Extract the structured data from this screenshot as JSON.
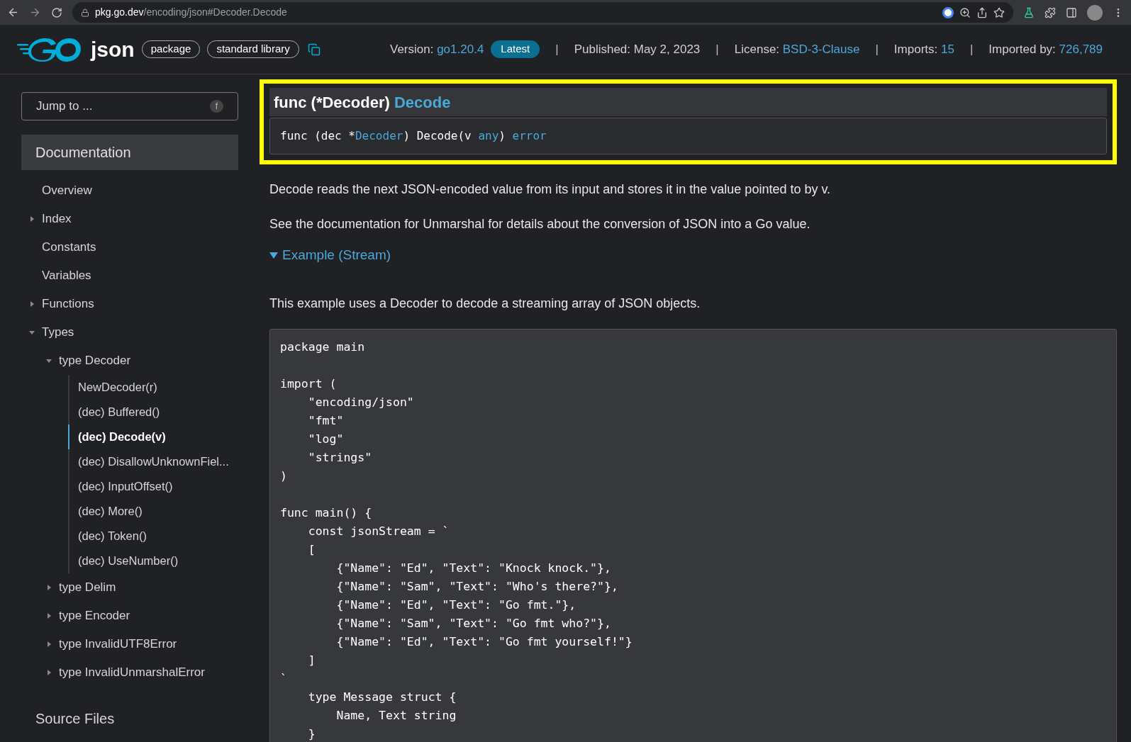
{
  "browser": {
    "url_host": "pkg.go.dev",
    "url_path": "/encoding/json#Decoder.Decode"
  },
  "header": {
    "title": "json",
    "badges": [
      "package",
      "standard library"
    ],
    "meta": [
      {
        "label": "Version: ",
        "value": "go1.20.4",
        "badge": "Latest"
      },
      {
        "separator": "|",
        "label": "Published: May 2, 2023"
      },
      {
        "separator": "|",
        "label": "License: ",
        "value": "BSD-3-Clause"
      },
      {
        "separator": "|",
        "label": "Imports: ",
        "value": "15"
      },
      {
        "separator": "|",
        "label": "Imported by: ",
        "value": "726,789"
      }
    ]
  },
  "sidebar": {
    "jump": {
      "placeholder": "Jump to ...",
      "shortcut": "f"
    },
    "section": "Documentation",
    "items": [
      {
        "label": "Overview"
      },
      {
        "label": "Index",
        "expanded": false
      },
      {
        "label": "Constants"
      },
      {
        "label": "Variables"
      },
      {
        "label": "Functions",
        "expanded": false
      },
      {
        "label": "Types",
        "expanded": true,
        "children": [
          {
            "label": "type Decoder",
            "expanded": true,
            "children": [
              {
                "label": "NewDecoder(r)",
                "selected": false
              },
              {
                "label": "(dec) Buffered()",
                "selected": false
              },
              {
                "label": "(dec) Decode(v)",
                "selected": true
              },
              {
                "label": "(dec) DisallowUnknownFiel...",
                "selected": false
              },
              {
                "label": "(dec) InputOffset()",
                "selected": false
              },
              {
                "label": "(dec) More()",
                "selected": false
              },
              {
                "label": "(dec) Token()",
                "selected": false
              },
              {
                "label": "(dec) UseNumber()",
                "selected": false
              }
            ]
          },
          {
            "label": "type Delim",
            "expanded": false
          },
          {
            "label": "type Encoder",
            "expanded": false
          },
          {
            "label": "type InvalidUTF8Error",
            "expanded": false
          },
          {
            "label": "type InvalidUnmarshalError",
            "expanded": false
          }
        ]
      }
    ],
    "footer": "Source Files"
  },
  "main": {
    "heading": {
      "prefix": "func (*Decoder) ",
      "name": "Decode"
    },
    "signature": [
      {
        "text": "func (dec *",
        "link": false
      },
      {
        "text": "Decoder",
        "link": true
      },
      {
        "text": ") Decode(v ",
        "link": false
      },
      {
        "text": "any",
        "link": true
      },
      {
        "text": ") ",
        "link": false
      },
      {
        "text": "error",
        "link": true
      }
    ],
    "paragraphs": [
      "Decode reads the next JSON-encoded value from its input and stores it in the value pointed to by v.",
      "See the documentation for Unmarshal for details about the conversion of JSON into a Go value."
    ],
    "example": {
      "label": "Example (Stream)",
      "expanded": true,
      "description": "This example uses a Decoder to decode a streaming array of JSON objects.",
      "code": "package main\n\nimport (\n\t\"encoding/json\"\n\t\"fmt\"\n\t\"log\"\n\t\"strings\"\n)\n\nfunc main() {\n\tconst jsonStream = `\n\t[\n\t\t{\"Name\": \"Ed\", \"Text\": \"Knock knock.\"},\n\t\t{\"Name\": \"Sam\", \"Text\": \"Who's there?\"},\n\t\t{\"Name\": \"Ed\", \"Text\": \"Go fmt.\"},\n\t\t{\"Name\": \"Sam\", \"Text\": \"Go fmt who?\"},\n\t\t{\"Name\": \"Ed\", \"Text\": \"Go fmt yourself!\"}\n\t]\n`\n\ttype Message struct {\n\t\tName, Text string\n\t}"
    }
  }
}
